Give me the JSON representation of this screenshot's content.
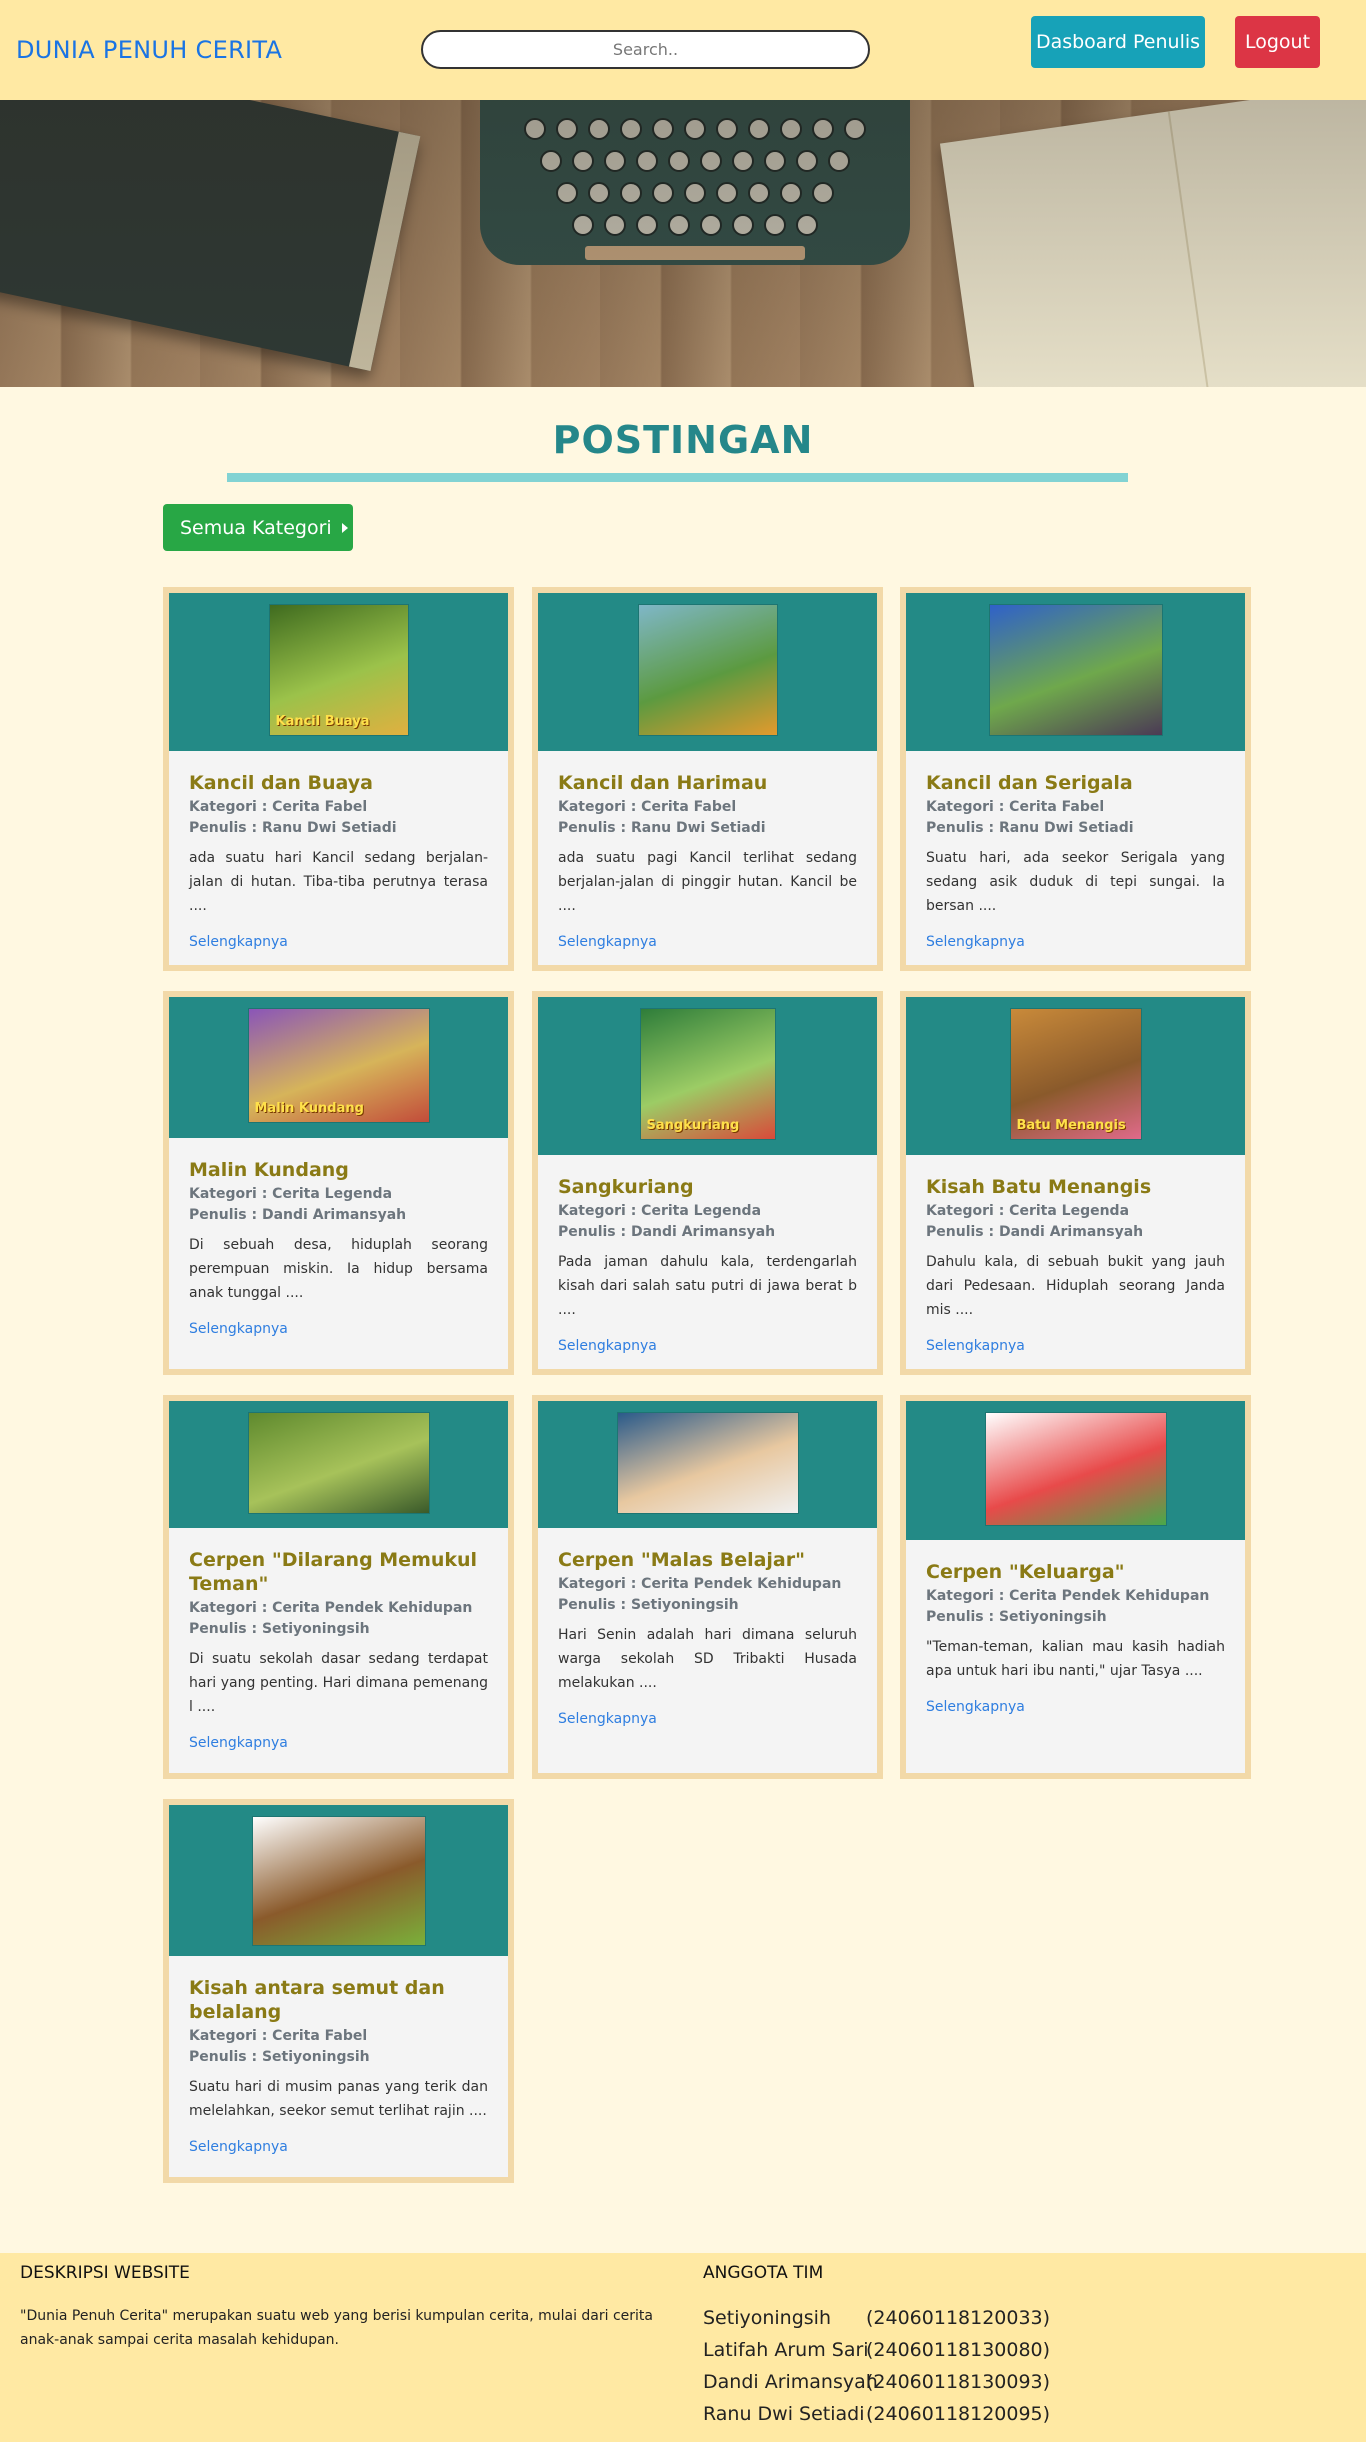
{
  "navbar": {
    "brand": "DUNIA PENUH CERITA",
    "search_placeholder": "Search..",
    "dashboard_label": "Dasboard Penulis",
    "logout_label": "Logout"
  },
  "section": {
    "title": "POSTINGAN",
    "category_button": "Semua Kategori"
  },
  "posts": [
    {
      "title": "Kancil dan Buaya",
      "kategori": "Kategori : Cerita Fabel",
      "penulis": "Penulis : Ranu Dwi Setiadi",
      "excerpt": "ada suatu hari Kancil sedang berjalan-jalan di hutan. Tiba-tiba perutnya terasa ....",
      "link": "Selengkapnya",
      "image_label": "Kancil Buaya",
      "image_colors": [
        "#3f6b1f",
        "#9bc24a",
        "#e0b040"
      ]
    },
    {
      "title": "Kancil dan Harimau",
      "kategori": "Kategori : Cerita Fabel",
      "penulis": "Penulis : Ranu Dwi Setiadi",
      "excerpt": "ada suatu pagi Kancil terlihat sedang berjalan-jalan di pinggir hutan. Kancil be ....",
      "link": "Selengkapnya",
      "image_label": "",
      "image_colors": [
        "#7fb7c8",
        "#5c9a40",
        "#e39a2d"
      ]
    },
    {
      "title": "Kancil dan Serigala",
      "kategori": "Kategori : Cerita Fabel",
      "penulis": "Penulis : Ranu Dwi Setiadi",
      "excerpt": "Suatu hari, ada seekor Serigala yang sedang asik duduk di tepi sungai. Ia bersan ....",
      "link": "Selengkapnya",
      "image_label": "",
      "image_colors": [
        "#2f61c9",
        "#6fa84c",
        "#4b3a55"
      ]
    },
    {
      "title": "Malin Kundang",
      "kategori": "Kategori : Cerita Legenda",
      "penulis": "Penulis : Dandi Arimansyah",
      "excerpt": "Di sebuah desa, hiduplah seorang perempuan miskin. Ia hidup bersama anak tunggal ....",
      "link": "Selengkapnya",
      "image_label": "Malin Kundang",
      "image_colors": [
        "#8a55b8",
        "#d6b45a",
        "#c24c3a"
      ]
    },
    {
      "title": "Sangkuriang",
      "kategori": "Kategori : Cerita Legenda",
      "penulis": "Penulis : Dandi Arimansyah",
      "excerpt": "Pada jaman dahulu kala, terdengarlah kisah dari salah satu putri di jawa berat b ....",
      "link": "Selengkapnya",
      "image_label": "Sangkuriang",
      "image_colors": [
        "#2e7d3a",
        "#9ccc65",
        "#d84a3a"
      ]
    },
    {
      "title": "Kisah Batu Menangis",
      "kategori": "Kategori : Cerita Legenda",
      "penulis": "Penulis : Dandi Arimansyah",
      "excerpt": "Dahulu kala, di sebuah bukit yang jauh dari Pedesaan. Hiduplah seorang Janda mis ....",
      "link": "Selengkapnya",
      "image_label": "Batu Menangis",
      "image_colors": [
        "#c98a3a",
        "#8a5a2b",
        "#e06a8a"
      ]
    },
    {
      "title": "Cerpen \"Dilarang Memukul Teman\"",
      "kategori": "Kategori : Cerita Pendek Kehidupan",
      "penulis": "Penulis : Setiyoningsih",
      "excerpt": "Di suatu sekolah dasar sedang terdapat hari yang penting. Hari dimana pemenang l ....",
      "link": "Selengkapnya",
      "image_label": "",
      "image_colors": [
        "#5f8a2e",
        "#a7c25a",
        "#3a5a2a"
      ]
    },
    {
      "title": "Cerpen \"Malas Belajar\"",
      "kategori": "Kategori : Cerita Pendek Kehidupan",
      "penulis": "Penulis : Setiyoningsih",
      "excerpt": "Hari Senin adalah hari dimana seluruh warga sekolah SD Tribakti Husada melakukan ....",
      "link": "Selengkapnya",
      "image_label": "",
      "image_colors": [
        "#2a5a8a",
        "#e8c8a0",
        "#f0f0f0"
      ]
    },
    {
      "title": "Cerpen \"Keluarga\"",
      "kategori": "Kategori : Cerita Pendek Kehidupan",
      "penulis": "Penulis : Setiyoningsih",
      "excerpt": "\"Teman-teman, kalian mau kasih hadiah apa untuk hari ibu nanti,\" ujar Tasya ....",
      "link": "Selengkapnya",
      "image_label": "",
      "image_colors": [
        "#ffffff",
        "#e84a4a",
        "#4aa84a"
      ]
    },
    {
      "title": "Kisah antara semut dan belalang",
      "kategori": "Kategori : Cerita Fabel",
      "penulis": "Penulis : Setiyoningsih",
      "excerpt": "Suatu hari di musim panas yang terik dan melelahkan, seekor semut terlihat rajin ....",
      "link": "Selengkapnya",
      "image_label": "",
      "image_colors": [
        "#ffffff",
        "#8a5a2b",
        "#7ab03a"
      ]
    }
  ],
  "footer": {
    "desc_title": "DESKRIPSI WEBSITE",
    "description": "\"Dunia Penuh Cerita\" merupakan suatu web yang berisi kumpulan cerita, mulai dari cerita anak-anak sampai cerita masalah kehidupan.",
    "team_title": "ANGGOTA TIM",
    "members": [
      {
        "name": "Setiyoningsih",
        "nim": "(24060118120033)"
      },
      {
        "name": "Latifah Arum Sari",
        "nim": "(24060118130080)"
      },
      {
        "name": "Dandi Arimansyah",
        "nim": "(24060118130093)"
      },
      {
        "name": "Ranu Dwi Setiadi",
        "nim": "(24060118120095)"
      }
    ]
  }
}
